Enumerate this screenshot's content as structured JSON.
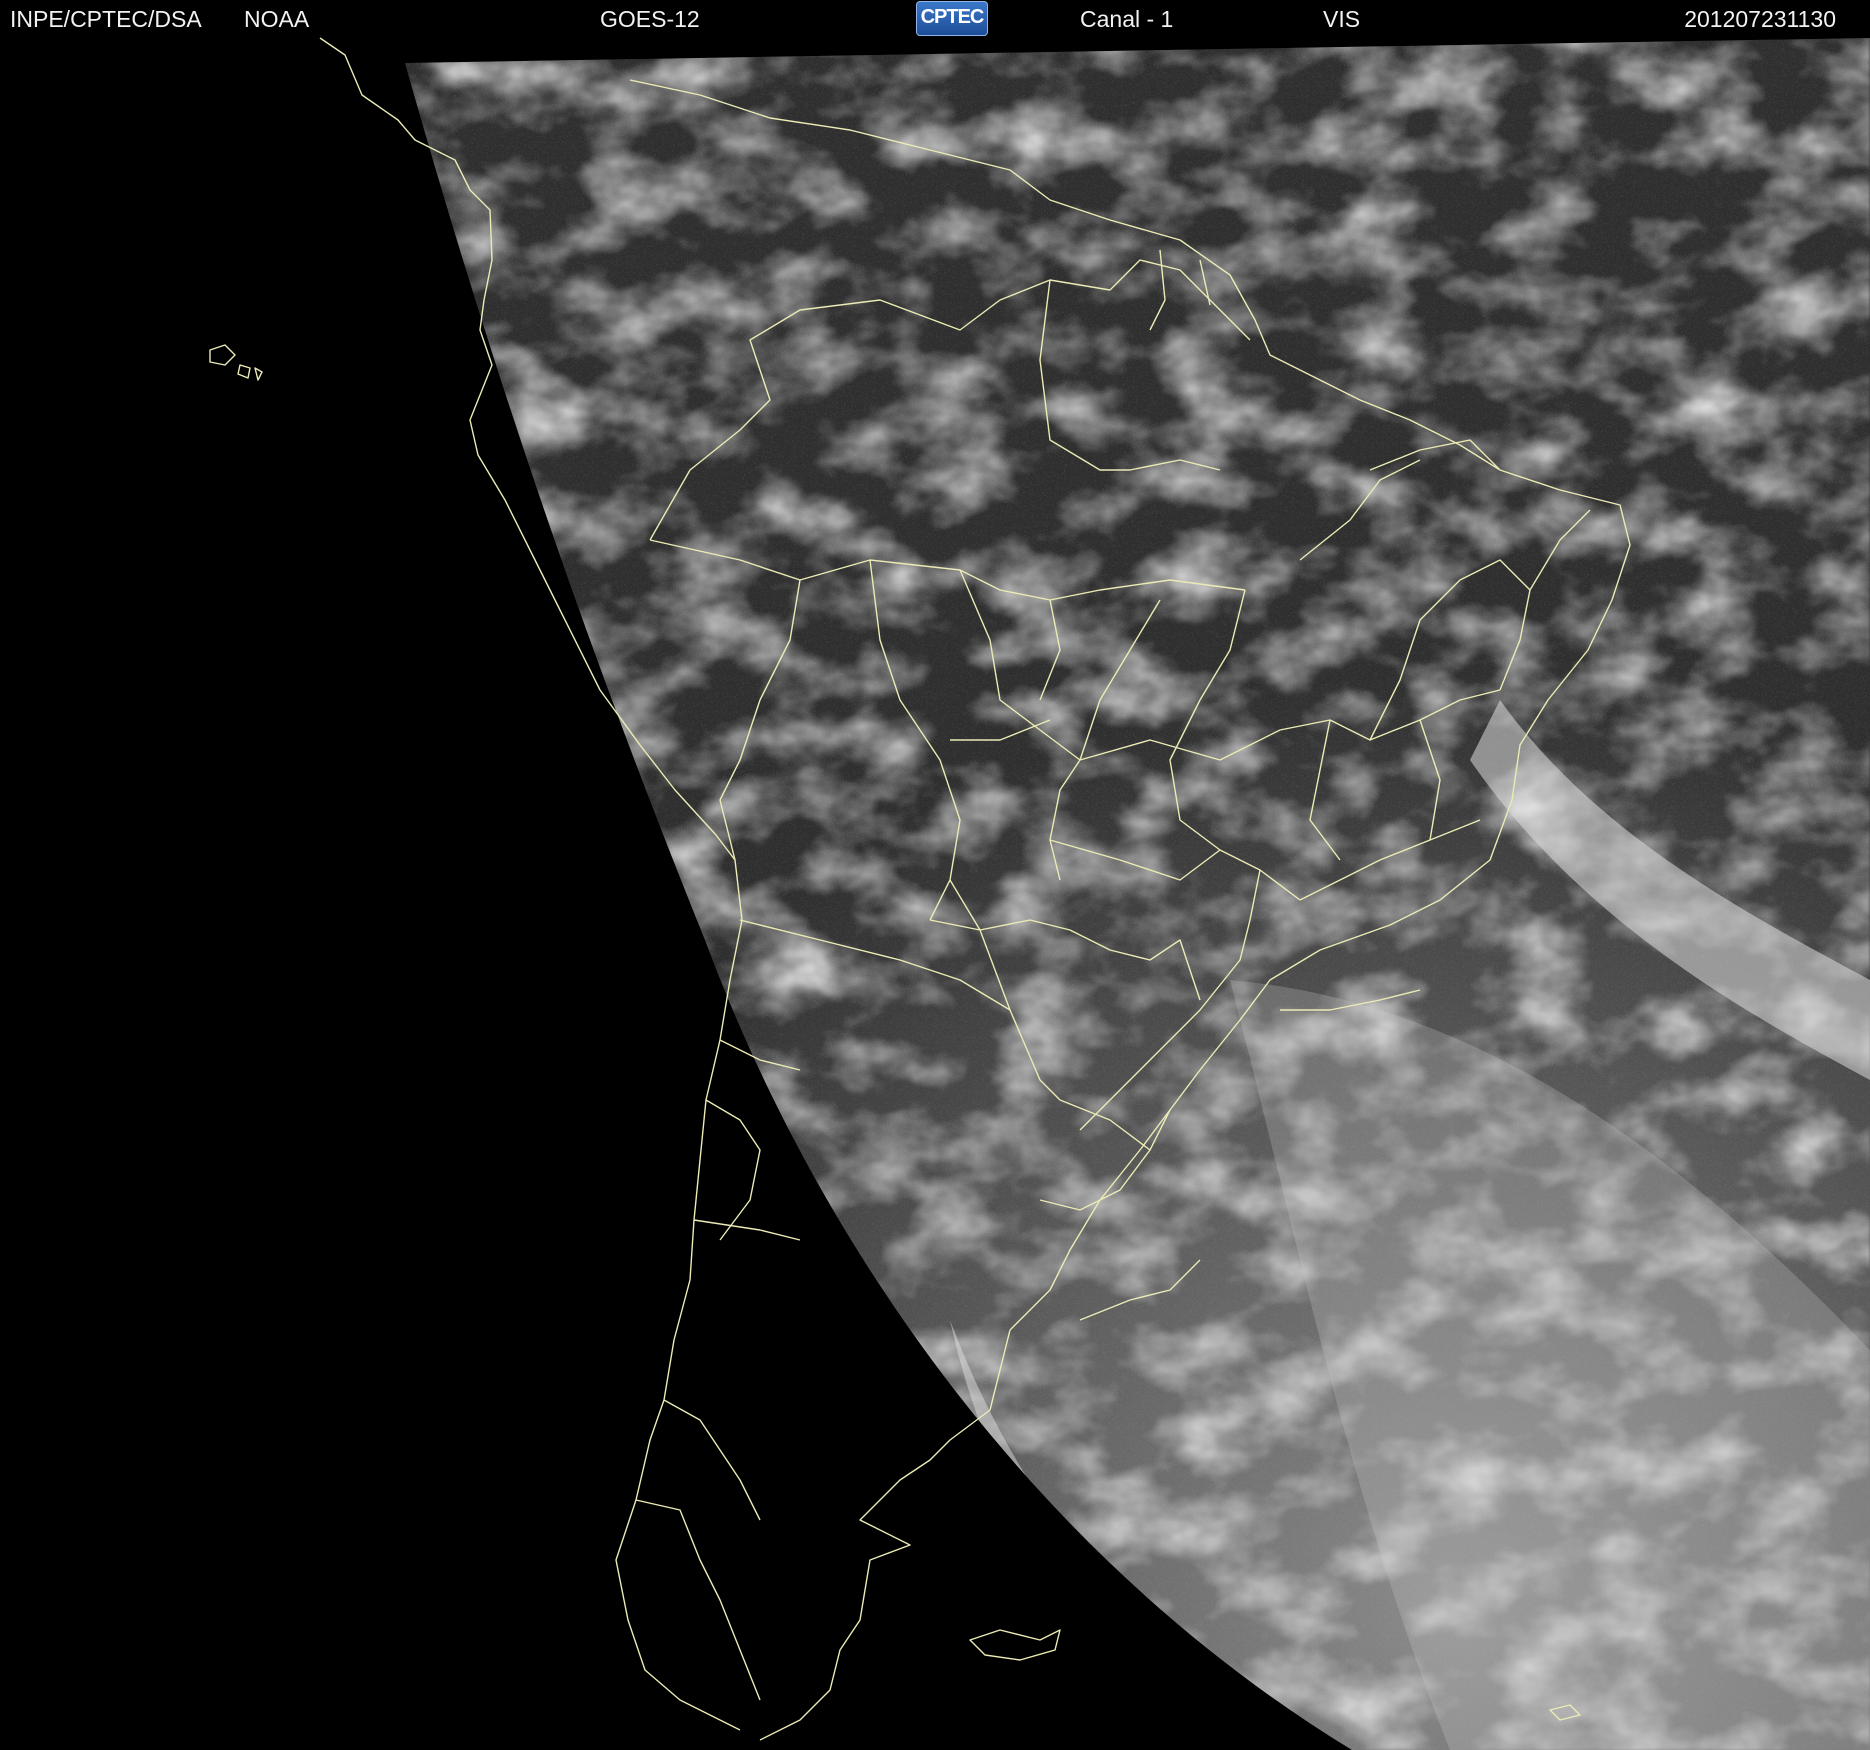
{
  "header": {
    "agency": "INPE/CPTEC/DSA",
    "source": "NOAA",
    "satellite": "GOES-12",
    "logo_text": "CPTEC",
    "channel": "Canal - 1",
    "band": "VIS",
    "timestamp": "201207231130"
  },
  "colors": {
    "background": "#000000",
    "header_text": "#f2f2f2",
    "land_fill": "#4a4a4a",
    "cloud": "#e6e6e6",
    "border_lines": "#ecebb5"
  }
}
